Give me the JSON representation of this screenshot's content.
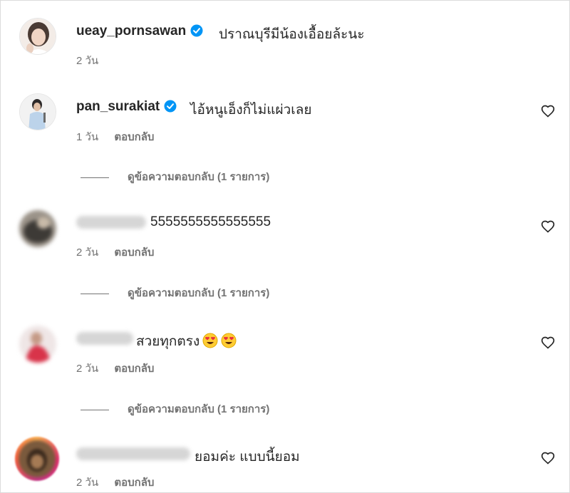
{
  "comments": [
    {
      "username": "ueay_pornsawan",
      "verified": true,
      "text": "ปราณบุรีมีน้องเอื้อยล้ะนะ",
      "time": "2 วัน",
      "reply_label": "",
      "has_heart": false,
      "view_replies": ""
    },
    {
      "username": "pan_surakiat",
      "verified": true,
      "text": "ไอ้หนูเอ็งก็ไม่แผ่วเลย",
      "time": "1 วัน",
      "reply_label": "ตอบกลับ",
      "has_heart": true,
      "view_replies": "ดูข้อความตอบกลับ (1 รายการ)"
    },
    {
      "username": "",
      "verified": false,
      "text": "5555555555555555",
      "time": "2 วัน",
      "reply_label": "ตอบกลับ",
      "has_heart": true,
      "view_replies": "ดูข้อความตอบกลับ (1 รายการ)"
    },
    {
      "username": "",
      "verified": false,
      "text": "สวยทุกตรง",
      "emoji": [
        "heart-eyes",
        "heart-eyes"
      ],
      "time": "2 วัน",
      "reply_label": "ตอบกลับ",
      "has_heart": true,
      "view_replies": "ดูข้อความตอบกลับ (1 รายการ)"
    },
    {
      "username": "",
      "verified": false,
      "text": "ยอมค่ะ แบบนี้ยอม",
      "time": "2 วัน",
      "reply_label": "ตอบกลับ",
      "has_heart": true,
      "view_replies": ""
    }
  ],
  "colors": {
    "verified": "#0095f6",
    "secondary_text": "#737373",
    "primary_text": "#262626",
    "story_ring": "#e1306c"
  },
  "icons": {
    "verified": "verified-badge-icon",
    "like": "heart-outline-icon"
  }
}
